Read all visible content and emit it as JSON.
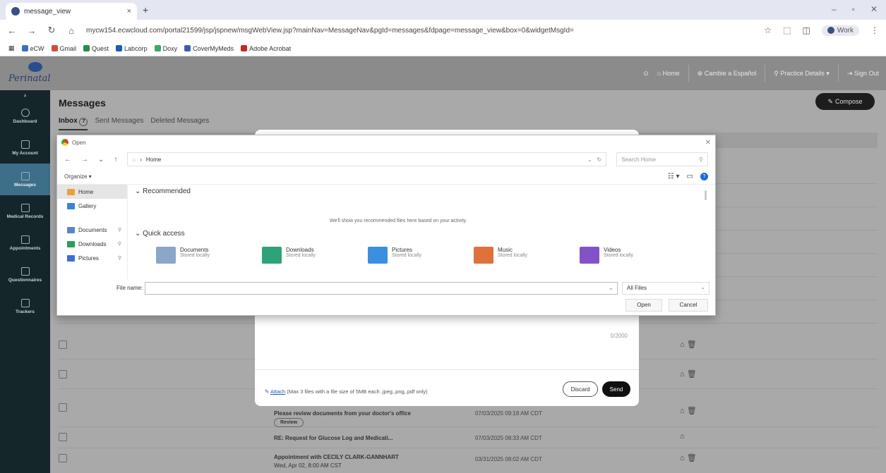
{
  "browser": {
    "tab_title": "message_view",
    "tab_close": "×",
    "new_tab": "+",
    "url": "mycw154.ecwcloud.com/portal21599/jsp/jspnew/msgWebView.jsp?mainNav=MessageNav&pgId=messages&fdpage=message_view&box=0&widgetMsgId=",
    "profile_label": "Work",
    "bookmarks": [
      "eCW",
      "Gmail",
      "Quest",
      "Labcorp",
      "Doxy",
      "CoverMyMeds",
      "Adobe Acrobat"
    ]
  },
  "header": {
    "logo_text": "Perinatal",
    "nav": [
      "Home",
      "Cambie a Español",
      "Practice Details",
      "Sign Out"
    ]
  },
  "sidebar": {
    "items": [
      {
        "label": "Dashboard"
      },
      {
        "label": "My Account"
      },
      {
        "label": "Messages"
      },
      {
        "label": "Medical Records"
      },
      {
        "label": "Appointments"
      },
      {
        "label": "Questionnaires"
      },
      {
        "label": "Trackers"
      }
    ]
  },
  "page": {
    "title": "Messages",
    "compose_label": "Compose",
    "tabs": {
      "inbox": "Inbox",
      "inbox_count": "7",
      "sent": "Sent Messages",
      "deleted": "Deleted Messages"
    }
  },
  "rows": [
    {
      "subject": "Please review documents from your doctor's office",
      "date": "07/03/2025 09:18 AM CDT",
      "review": "Review"
    },
    {
      "subject": "RE: Request for Glucose Log and Medicati...",
      "date": "07/03/2025 08:33 AM CDT"
    },
    {
      "subject": "Appointment with CECILY CLARK-GANNHART",
      "subject2": "Wed, Apr 02, 8:00 AM CST",
      "date": "03/31/2025 08:02 AM CDT"
    }
  ],
  "compose_modal": {
    "char_count": "0/2000",
    "attach_link": "Attach",
    "attach_hint": "(Max 3 files with a file size of 5MB each .jpeg,.png,.pdf only)",
    "discard": "Discard",
    "send": "Send"
  },
  "file_dialog": {
    "title": "Open",
    "path": "Home",
    "search_placeholder": "Search Home",
    "organize": "Organize ▾",
    "sidebar": [
      {
        "label": "Home",
        "color": "#e8a23a"
      },
      {
        "label": "Gallery",
        "color": "#3b82d6"
      },
      {
        "label": "Documents",
        "color": "#5a86c5"
      },
      {
        "label": "Downloads",
        "color": "#2a9d5a"
      },
      {
        "label": "Pictures",
        "color": "#3b6fd6"
      }
    ],
    "recommended_heading": "Recommended",
    "recommended_empty": "We'll show you recommended files here based on your activity.",
    "quick_access_heading": "Quick access",
    "quick_access": [
      {
        "name": "Documents",
        "sub": "Stored locally",
        "color": "#8aa6c8"
      },
      {
        "name": "Downloads",
        "sub": "Stored locally",
        "color": "#2ea378"
      },
      {
        "name": "Pictures",
        "sub": "Stored locally",
        "color": "#3c8fe0"
      },
      {
        "name": "Music",
        "sub": "Stored locally",
        "color": "#e0703c"
      },
      {
        "name": "Videos",
        "sub": "Stored locally",
        "color": "#8452c8"
      }
    ],
    "file_name_label": "File name:",
    "file_type": "All Files",
    "open_button": "Open",
    "cancel_button": "Cancel"
  }
}
